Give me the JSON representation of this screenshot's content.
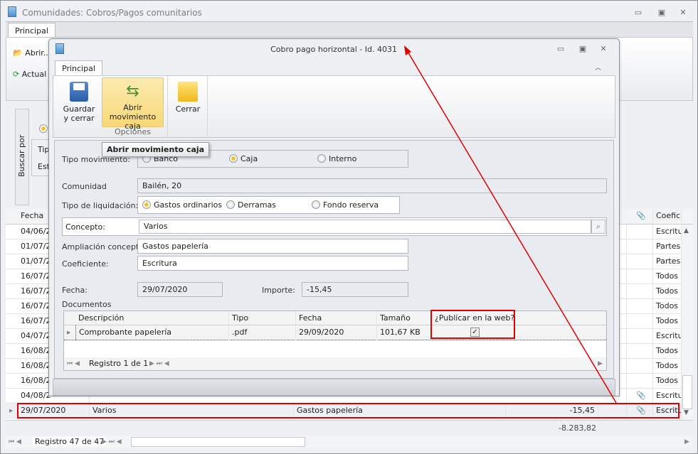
{
  "main": {
    "title": "Comunidades: Cobros/Pagos comunitarios",
    "tab": "Principal",
    "ribbon": [
      "Abrir...",
      "Actual"
    ],
    "search_label": "Buscar por",
    "search_items": [
      "Tip",
      "Est"
    ],
    "columns": [
      "Fecha",
      "Coeficiente"
    ],
    "rows": [
      {
        "fecha": "04/06/2",
        "coef": "Escritu"
      },
      {
        "fecha": "01/07/2",
        "coef": "Partes"
      },
      {
        "fecha": "01/07/2",
        "coef": "Partes"
      },
      {
        "fecha": "16/07/2",
        "coef": "Todos r"
      },
      {
        "fecha": "16/07/2",
        "coef": "Todos r"
      },
      {
        "fecha": "16/07/2",
        "coef": "Todos r"
      },
      {
        "fecha": "16/07/2",
        "coef": "Todos r"
      },
      {
        "fecha": "04/07/2",
        "coef": "Escritu"
      },
      {
        "fecha": "16/08/2",
        "coef": "Todos r"
      },
      {
        "fecha": "16/08/2",
        "coef": "Todos r"
      },
      {
        "fecha": "16/08/2",
        "coef": "Todos r"
      },
      {
        "fecha": "04/08/2",
        "coef": "Escritu",
        "clip": true
      }
    ],
    "selected": {
      "fecha": "29/07/2020",
      "concepto": "Varios",
      "ampliacion": "Gastos papelería",
      "importe": "-15,45",
      "coef": "Escritu"
    },
    "total": "-8.283,82",
    "navigator": "Registro 47 de 47"
  },
  "dialog": {
    "title": "Cobro pago horizontal - Id. 4031",
    "tab": "Principal",
    "buttons": {
      "save": "Guardar\ny cerrar",
      "open": "Abrir\nmovimiento caja",
      "close": "Cerrar"
    },
    "group": "Opciones",
    "tooltip": "Abrir movimiento caja",
    "tipo_mov": {
      "label": "Tipo movimiento:",
      "options": [
        "Banco",
        "Caja",
        "Interno"
      ],
      "selected": "Caja"
    },
    "comunidad": {
      "label": "Comunidad",
      "value": "Bailén, 20"
    },
    "tipo_liq": {
      "label": "Tipo de liquidación:",
      "options": [
        "Gastos ordinarios",
        "Derramas",
        "Fondo reserva"
      ],
      "selected": "Gastos ordinarios"
    },
    "concepto": {
      "label": "Concepto:",
      "value": "Varios"
    },
    "ampliacion": {
      "label": "Ampliación concepto:",
      "value": "Gastos papelería"
    },
    "coeficiente": {
      "label": "Coeficiente:",
      "value": "Escritura"
    },
    "fecha": {
      "label": "Fecha:",
      "value": "29/07/2020"
    },
    "importe": {
      "label": "Importe:",
      "value": "-15,45"
    },
    "documentos": {
      "label": "Documentos",
      "columns": [
        "Descripción",
        "Tipo",
        "Fecha",
        "Tamaño",
        "¿Publicar en la web?"
      ],
      "rows": [
        {
          "descripcion": "Comprobante papelería",
          "tipo": ".pdf",
          "fecha": "29/09/2020",
          "tamano": "101,67 KB",
          "publicar": true
        }
      ],
      "navigator": "Registro 1 de 1"
    }
  },
  "colors": {
    "annotation": "#e00000",
    "radio_selected": "#f7c21a"
  }
}
